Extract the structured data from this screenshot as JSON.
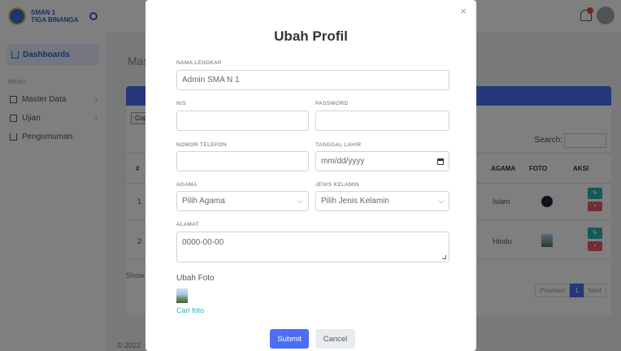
{
  "sidebar": {
    "brand_line1": "SMAN 1",
    "brand_line2": "TIGA BINANGA",
    "active_item": "Dashboards",
    "section_header": "MENU",
    "items": [
      {
        "label": "Master Data",
        "icon": "database-icon"
      },
      {
        "label": "Ujian",
        "icon": "exam-icon"
      },
      {
        "label": "Pengumuman",
        "icon": "announcement-icon"
      }
    ]
  },
  "main": {
    "page_heading": "Mas",
    "copy_button": "Copy",
    "search_label": "Search:",
    "table_headers": {
      "no": "#",
      "agama": "AGAMA",
      "foto": "FOTO",
      "aksi": "AKSI"
    },
    "rows": [
      {
        "no": "1",
        "agama": "Islam"
      },
      {
        "no": "2",
        "agama": "Hindu"
      }
    ],
    "show_text": "Show",
    "pager": {
      "prev": "Previous",
      "current": "1",
      "next": "Next"
    },
    "footer": "© 2022"
  },
  "modal": {
    "title": "Ubah Profil",
    "close_label": "×",
    "fields": {
      "nama_lengkap": {
        "label": "NAMA LENGKAP",
        "value": "Admin SMA N 1"
      },
      "nis": {
        "label": "NIS",
        "value": ""
      },
      "password": {
        "label": "PASSWORD",
        "value": ""
      },
      "nomor_telepon": {
        "label": "NOMOR TELEPON",
        "value": ""
      },
      "tanggal_lahir": {
        "label": "TANGGAL LAHIR",
        "value": "mm/dd/yyyy"
      },
      "agama": {
        "label": "AGAMA",
        "value": "Pilih Agama"
      },
      "jenis_kelamin": {
        "label": "JENIS KELAMIN",
        "value": "Pilih Jenis Kelamin"
      },
      "alamat": {
        "label": "ALAMAT",
        "value": "0000-00-00"
      }
    },
    "foto_label": "Ubah Foto",
    "foto_link": "Cari foto",
    "submit_label": "Submit",
    "cancel_label": "Cancel"
  },
  "colors": {
    "primary": "#4c6ef5",
    "info": "#2bb5b5",
    "danger": "#e85a6a",
    "backdrop": "rgba(0,0,0,0.5)"
  }
}
